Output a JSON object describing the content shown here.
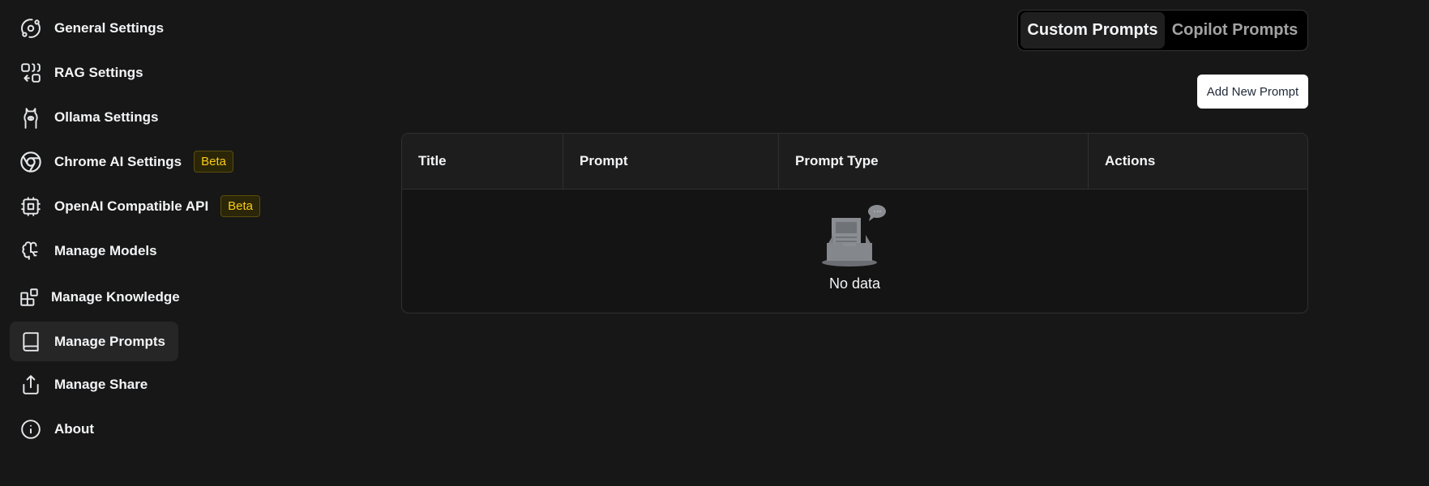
{
  "sidebar": {
    "items": [
      {
        "label": "General Settings",
        "icon": "orbit-icon"
      },
      {
        "label": "RAG Settings",
        "icon": "combine-icon"
      },
      {
        "label": "Ollama Settings",
        "icon": "ollama-icon"
      },
      {
        "label": "Chrome AI Settings",
        "icon": "chrome-icon",
        "badge": "Beta"
      },
      {
        "label": "OpenAI Compatible API",
        "icon": "cpu-icon",
        "badge": "Beta"
      },
      {
        "label": "Manage Models",
        "icon": "brain-icon"
      },
      {
        "label": "Manage Knowledge",
        "icon": "blocks-icon"
      },
      {
        "label": "Manage Prompts",
        "icon": "book-icon",
        "active": true
      },
      {
        "label": "Manage Share",
        "icon": "share-icon"
      },
      {
        "label": "About",
        "icon": "info-icon"
      }
    ]
  },
  "tabs": {
    "custom": "Custom Prompts",
    "copilot": "Copilot Prompts",
    "active": "Custom Prompts"
  },
  "toolbar": {
    "add_label": "Add New Prompt"
  },
  "table": {
    "columns": [
      "Title",
      "Prompt",
      "Prompt Type",
      "Actions"
    ],
    "rows": [],
    "empty_text": "No data"
  },
  "colors": {
    "background": "#171717",
    "badge": "#facc15"
  }
}
